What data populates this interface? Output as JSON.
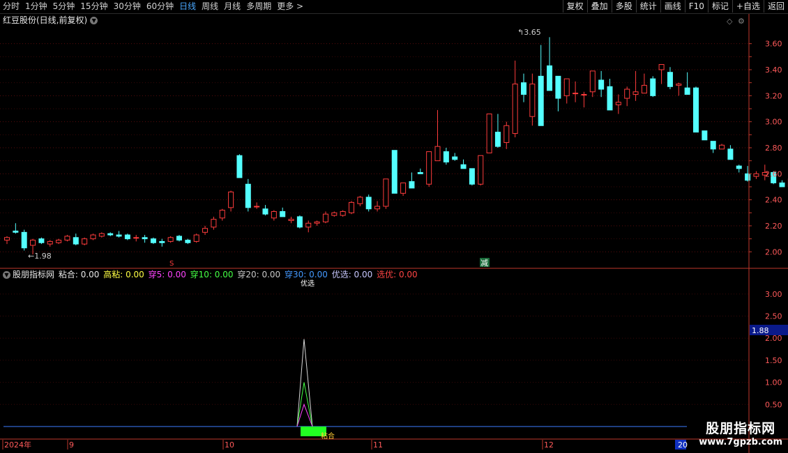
{
  "toolbar": {
    "periods": [
      "分时",
      "1分钟",
      "5分钟",
      "15分钟",
      "30分钟",
      "60分钟",
      "日线",
      "周线",
      "月线",
      "多周期",
      "更多 >"
    ],
    "right_buttons": [
      "复权",
      "叠加",
      "多股",
      "统计",
      "画线",
      "F10",
      "标记",
      "+自选",
      "返回"
    ]
  },
  "header": {
    "title": "红豆股份(日线,前复权)"
  },
  "indicator": {
    "name": "股朋指标网",
    "items": [
      {
        "label": "粘合:",
        "value": "0.00",
        "color": "#e6e6e6"
      },
      {
        "label": "高粘:",
        "value": "0.00",
        "color": "#ffff44"
      },
      {
        "label": "穿5:",
        "value": "0.00",
        "color": "#ff44ff"
      },
      {
        "label": "穿10:",
        "value": "0.00",
        "color": "#44ff44"
      },
      {
        "label": "穿20:",
        "value": "0.00",
        "color": "#c8c8c8"
      },
      {
        "label": "穿30:",
        "value": "0.00",
        "color": "#4499ff"
      },
      {
        "label": "优选:",
        "value": "0.00",
        "color": "#c8c8ff"
      },
      {
        "label": "选优:",
        "value": "0.00",
        "color": "#ff4444"
      }
    ],
    "top_marker": "优选",
    "bottom_marker": "粘合",
    "cursor_value": "1.88"
  },
  "price_axis": [
    "3.60",
    "3.40",
    "3.20",
    "3.00",
    "2.80",
    "2.60",
    "2.40",
    "2.20",
    "2.00"
  ],
  "indicator_axis": [
    "3.00",
    "2.50",
    "2.00",
    "1.50",
    "1.00",
    "0.50"
  ],
  "annotations": {
    "high": "3.65",
    "low": "1.98",
    "marker_s": "S",
    "marker_jian": "减"
  },
  "time_axis": [
    "2024年",
    "9",
    "10",
    "11",
    "12",
    "20"
  ],
  "watermark": {
    "title": "股朋指标网",
    "url": "www.7gpzb.com"
  },
  "colors": {
    "up": "#ff3c3c",
    "down": "#54ffff",
    "grid": "#7a1010",
    "axis": "#c0392b"
  },
  "chart_data": {
    "type": "candlestick",
    "ylim": [
      1.9,
      3.7
    ],
    "candles": [
      [
        2.09,
        2.12,
        2.06,
        2.11
      ],
      [
        2.16,
        2.22,
        2.14,
        2.15
      ],
      [
        2.15,
        2.17,
        2.01,
        2.03
      ],
      [
        2.05,
        2.1,
        1.98,
        2.09
      ],
      [
        2.1,
        2.11,
        2.06,
        2.07
      ],
      [
        2.06,
        2.09,
        2.04,
        2.08
      ],
      [
        2.07,
        2.1,
        2.06,
        2.09
      ],
      [
        2.09,
        2.13,
        2.08,
        2.12
      ],
      [
        2.11,
        2.14,
        2.05,
        2.06
      ],
      [
        2.06,
        2.11,
        2.05,
        2.1
      ],
      [
        2.1,
        2.14,
        2.09,
        2.13
      ],
      [
        2.12,
        2.15,
        2.11,
        2.14
      ],
      [
        2.14,
        2.15,
        2.12,
        2.13
      ],
      [
        2.13,
        2.16,
        2.11,
        2.12
      ],
      [
        2.13,
        2.14,
        2.09,
        2.1
      ],
      [
        2.11,
        2.13,
        2.08,
        2.11
      ],
      [
        2.11,
        2.13,
        2.07,
        2.1
      ],
      [
        2.1,
        2.11,
        2.06,
        2.07
      ],
      [
        2.08,
        2.1,
        2.04,
        2.07
      ],
      [
        2.08,
        2.12,
        2.07,
        2.11
      ],
      [
        2.12,
        2.13,
        2.08,
        2.09
      ],
      [
        2.09,
        2.1,
        2.06,
        2.07
      ],
      [
        2.08,
        2.14,
        2.07,
        2.13
      ],
      [
        2.15,
        2.2,
        2.13,
        2.18
      ],
      [
        2.19,
        2.27,
        2.17,
        2.25
      ],
      [
        2.26,
        2.33,
        2.24,
        2.32
      ],
      [
        2.34,
        2.47,
        2.31,
        2.46
      ],
      [
        2.74,
        2.75,
        2.57,
        2.57
      ],
      [
        2.52,
        2.56,
        2.31,
        2.34
      ],
      [
        2.35,
        2.38,
        2.33,
        2.35
      ],
      [
        2.33,
        2.36,
        2.28,
        2.29
      ],
      [
        2.26,
        2.32,
        2.24,
        2.31
      ],
      [
        2.31,
        2.34,
        2.27,
        2.27
      ],
      [
        2.24,
        2.27,
        2.22,
        2.25
      ],
      [
        2.27,
        2.28,
        2.18,
        2.19
      ],
      [
        2.19,
        2.24,
        2.15,
        2.22
      ],
      [
        2.22,
        2.24,
        2.2,
        2.23
      ],
      [
        2.23,
        2.31,
        2.22,
        2.29
      ],
      [
        2.28,
        2.31,
        2.27,
        2.3
      ],
      [
        2.28,
        2.32,
        2.27,
        2.31
      ],
      [
        2.3,
        2.39,
        2.29,
        2.38
      ],
      [
        2.37,
        2.43,
        2.35,
        2.42
      ],
      [
        2.42,
        2.44,
        2.31,
        2.33
      ],
      [
        2.33,
        2.39,
        2.31,
        2.35
      ],
      [
        2.35,
        2.56,
        2.33,
        2.56
      ],
      [
        2.78,
        2.78,
        2.45,
        2.45
      ],
      [
        2.45,
        2.52,
        2.43,
        2.53
      ],
      [
        2.54,
        2.61,
        2.49,
        2.49
      ],
      [
        2.61,
        2.64,
        2.6,
        2.6
      ],
      [
        2.52,
        2.77,
        2.5,
        2.77
      ],
      [
        2.7,
        3.09,
        2.75,
        2.81
      ],
      [
        2.77,
        2.8,
        2.67,
        2.69
      ],
      [
        2.73,
        2.76,
        2.7,
        2.71
      ],
      [
        2.67,
        2.71,
        2.64,
        2.64
      ],
      [
        2.64,
        2.63,
        2.51,
        2.52
      ],
      [
        2.52,
        2.59,
        2.51,
        2.74
      ],
      [
        2.76,
        3.06,
        2.76,
        3.06
      ],
      [
        2.92,
        3.06,
        2.8,
        2.81
      ],
      [
        2.84,
        3.0,
        2.79,
        2.97
      ],
      [
        2.91,
        3.47,
        2.88,
        3.29
      ],
      [
        3.3,
        3.37,
        3.15,
        3.21
      ],
      [
        3.04,
        3.37,
        2.97,
        3.29
      ],
      [
        3.35,
        3.59,
        3.02,
        2.97
      ],
      [
        3.43,
        3.65,
        3.24,
        3.24
      ],
      [
        3.35,
        3.19,
        3.08,
        3.18
      ],
      [
        3.2,
        3.21,
        3.14,
        3.33
      ],
      [
        3.22,
        3.31,
        3.15,
        3.22
      ],
      [
        3.21,
        3.23,
        3.11,
        3.21
      ],
      [
        3.23,
        3.38,
        3.19,
        3.39
      ],
      [
        3.32,
        3.39,
        3.19,
        3.25
      ],
      [
        3.27,
        3.33,
        3.09,
        3.09
      ],
      [
        3.13,
        3.21,
        3.06,
        3.15
      ],
      [
        3.18,
        3.27,
        3.12,
        3.25
      ],
      [
        3.21,
        3.39,
        3.16,
        3.23
      ],
      [
        3.22,
        3.37,
        3.22,
        3.28
      ],
      [
        3.33,
        3.35,
        3.19,
        3.2
      ],
      [
        3.4,
        3.44,
        3.29,
        3.44
      ],
      [
        3.38,
        3.42,
        3.25,
        3.27
      ],
      [
        3.28,
        3.3,
        3.2,
        3.29
      ],
      [
        3.26,
        3.38,
        3.21,
        3.21
      ],
      [
        3.26,
        3.27,
        2.92,
        2.92
      ],
      [
        2.93,
        2.93,
        2.86,
        2.86
      ],
      [
        2.85,
        2.85,
        2.76,
        2.79
      ],
      [
        2.79,
        2.83,
        2.79,
        2.82
      ],
      [
        2.79,
        2.82,
        2.72,
        2.71
      ],
      [
        2.66,
        2.67,
        2.61,
        2.64
      ],
      [
        2.6,
        2.66,
        2.54,
        2.55
      ],
      [
        2.58,
        2.62,
        2.56,
        2.6
      ],
      [
        2.59,
        2.67,
        2.55,
        2.61
      ],
      [
        2.61,
        2.62,
        2.52,
        2.53
      ],
      [
        2.53,
        2.55,
        2.5,
        2.5
      ],
      [
        2.5,
        2.64,
        2.51,
        2.56
      ],
      [
        2.54,
        2.56,
        2.31,
        2.38
      ],
      [
        2.39,
        2.43,
        2.3,
        2.35
      ],
      [
        2.36,
        2.42,
        2.35,
        2.42
      ]
    ],
    "indicator_ylim": [
      0,
      3.3
    ],
    "indicator_peaks": [
      {
        "name": "穿20",
        "value": 1.98,
        "color": "#d8d8d8"
      },
      {
        "name": "穿10",
        "value": 1.0,
        "color": "#44ff44"
      },
      {
        "name": "穿5",
        "value": 0.5,
        "color": "#ff44ff"
      }
    ]
  }
}
